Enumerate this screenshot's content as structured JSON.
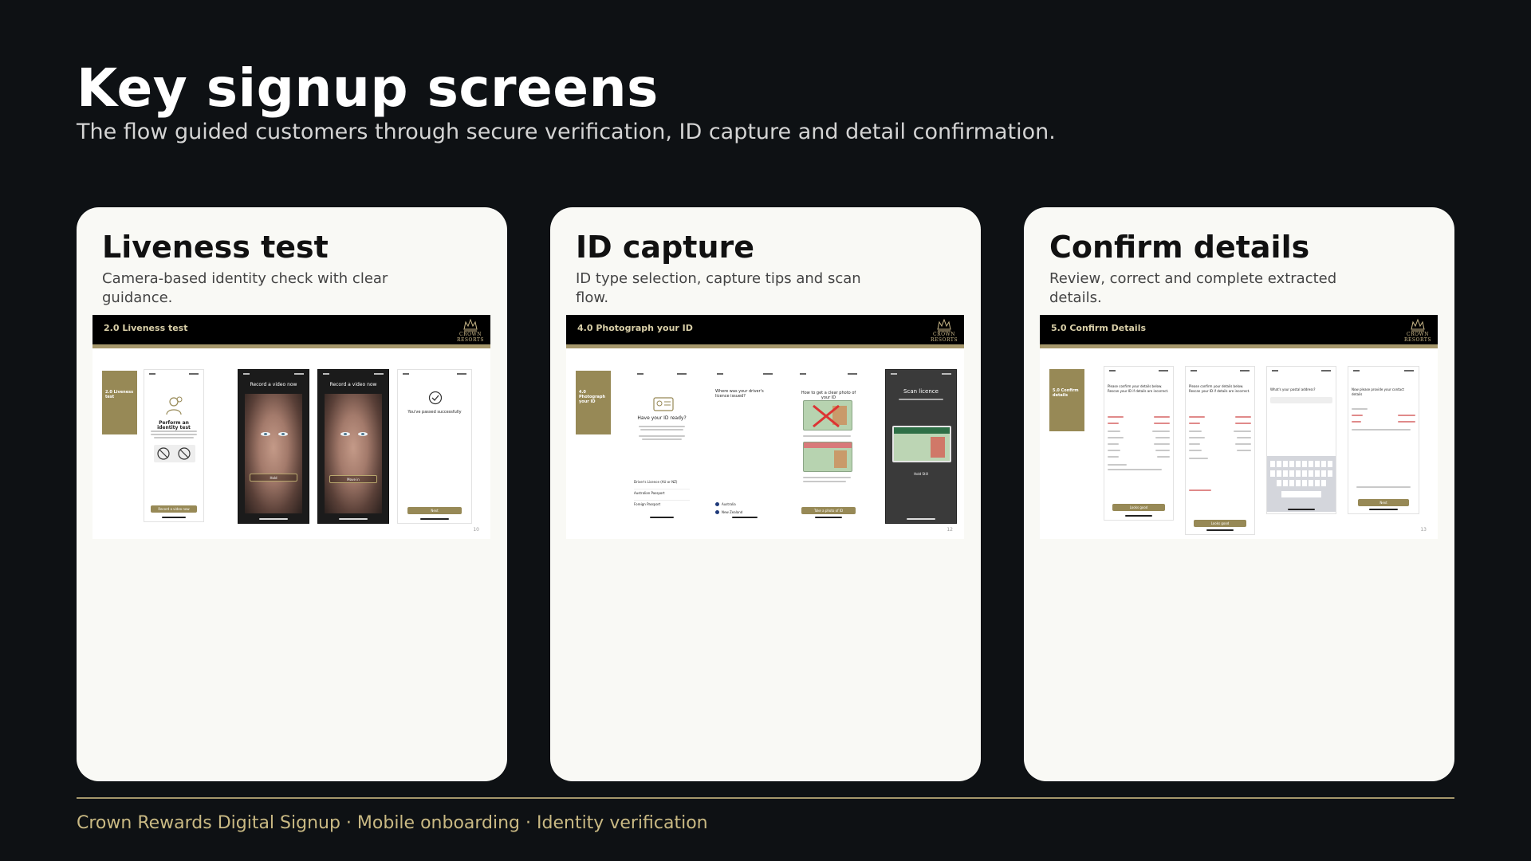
{
  "page": {
    "title": "Key signup screens",
    "subtitle": "The flow guided customers through secure verification, ID capture and detail confirmation."
  },
  "cards": [
    {
      "title": "Liveness test",
      "description": "Camera-based identity check with clear guidance.",
      "slide": {
        "bar_title": "2.0 Liveness test",
        "section_tab": "2.0 Liveness test",
        "page_number": "10",
        "phones": {
          "intro_heading": "Perform an identity test",
          "intro_button": "Record a video now",
          "record_heading": "Record a video now",
          "record_hint_1": "Hold",
          "record_hint_2": "Move in",
          "success_text": "You've passed successfully",
          "success_button": "Next"
        }
      }
    },
    {
      "title": "ID capture",
      "description": "ID type selection, capture tips and scan flow.",
      "slide": {
        "bar_title": "4.0 Photograph your ID",
        "section_tab": "4.0 Photograph your ID",
        "page_number": "12",
        "phones": {
          "ready_heading": "Have your ID ready?",
          "licence_question": "Where was your driver's licence issued?",
          "tips_heading": "How to get a clear photo of your ID",
          "tips_button": "Take a photo of ID",
          "scan_heading": "Scan licence",
          "scan_hint": "Hold Still",
          "id_options": [
            "Driver's Licence (AU or NZ)",
            "Australian Passport",
            "Foreign Passport"
          ],
          "country_options": [
            "Australia",
            "New Zealand"
          ]
        }
      }
    },
    {
      "title": "Confirm details",
      "description": "Review, correct and complete extracted details.",
      "slide": {
        "bar_title": "5.0 Confirm Details",
        "section_tab": "5.0 Confirm details",
        "page_number": "13",
        "phones": {
          "confirm_heading": "Please confirm your details below. Rescan your ID if details are incorrect.",
          "postal_heading": "What's your postal address?",
          "contact_heading": "Now please provide your contact details",
          "button": "Looks good",
          "next_button": "Next"
        }
      }
    }
  ],
  "brand": {
    "logo_line1": "CROWN",
    "logo_line2": "RESORTS"
  },
  "footer": {
    "text": "Crown Rewards Digital Signup · Mobile onboarding · Identity verification"
  },
  "colors": {
    "background": "#0e1114",
    "card": "#f9f9f5",
    "accent_gold": "#a5976b",
    "footer_text": "#c9b983"
  }
}
